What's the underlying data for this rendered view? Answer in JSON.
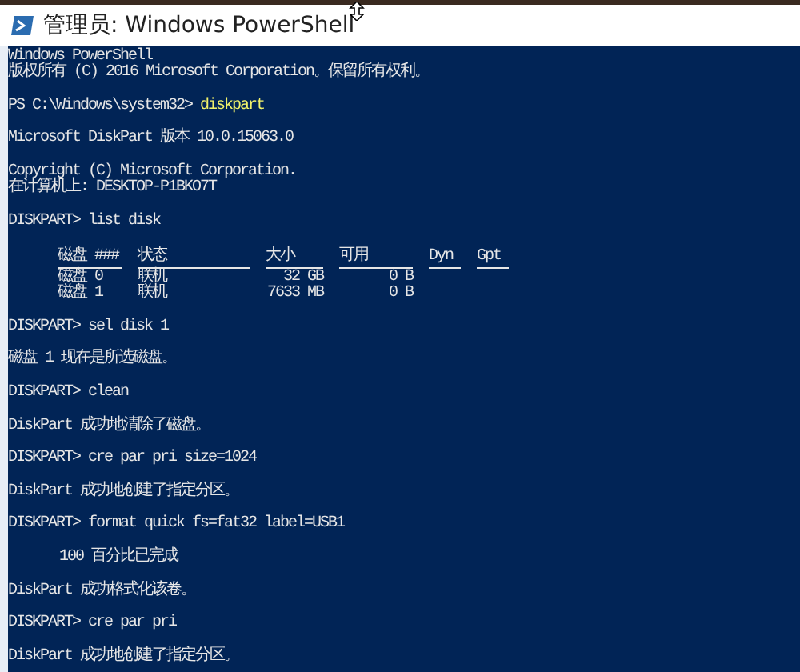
{
  "window": {
    "title": "管理员: Windows PowerShell"
  },
  "console": [
    {
      "kind": "text",
      "text": "Windows PowerShell"
    },
    {
      "kind": "text",
      "text": "版权所有 (C) 2016 Microsoft Corporation。保留所有权利。"
    },
    {
      "kind": "blank"
    },
    {
      "kind": "ps_command",
      "prompt": "PS C:\\Windows\\system32> ",
      "command": "diskpart"
    },
    {
      "kind": "blank"
    },
    {
      "kind": "text",
      "text": "Microsoft DiskPart 版本 10.0.15063.0"
    },
    {
      "kind": "blank"
    },
    {
      "kind": "text",
      "text": "Copyright (C) Microsoft Corporation."
    },
    {
      "kind": "text",
      "text": "在计算机上: DESKTOP-P1BKO7T"
    },
    {
      "kind": "blank"
    },
    {
      "kind": "text",
      "text": "DISKPART> list disk"
    },
    {
      "kind": "blank"
    },
    {
      "kind": "table",
      "columns": [
        "磁盘 ###",
        "状态",
        "大小",
        "可用",
        "Dyn",
        "Gpt"
      ],
      "rows": [
        [
          "磁盘 0",
          "联机",
          "32 GB",
          "0 B"
        ],
        [
          "磁盘 1",
          "联机",
          "7633 MB",
          "0 B"
        ]
      ]
    },
    {
      "kind": "blank"
    },
    {
      "kind": "text",
      "text": "DISKPART> sel disk 1"
    },
    {
      "kind": "blank"
    },
    {
      "kind": "text",
      "text": "磁盘 1 现在是所选磁盘。"
    },
    {
      "kind": "blank"
    },
    {
      "kind": "text",
      "text": "DISKPART> clean"
    },
    {
      "kind": "blank"
    },
    {
      "kind": "text",
      "text": "DiskPart 成功地清除了磁盘。"
    },
    {
      "kind": "blank"
    },
    {
      "kind": "text",
      "text": "DISKPART> cre par pri size=1024"
    },
    {
      "kind": "blank"
    },
    {
      "kind": "text",
      "text": "DiskPart 成功地创建了指定分区。"
    },
    {
      "kind": "blank"
    },
    {
      "kind": "text",
      "text": "DISKPART> format quick fs=fat32 label=USB1"
    },
    {
      "kind": "blank"
    },
    {
      "kind": "indented",
      "text": "100 百分比已完成"
    },
    {
      "kind": "blank"
    },
    {
      "kind": "text",
      "text": "DiskPart 成功格式化该卷。"
    },
    {
      "kind": "blank"
    },
    {
      "kind": "text",
      "text": "DISKPART> cre par pri"
    },
    {
      "kind": "blank"
    },
    {
      "kind": "text",
      "text": "DiskPart 成功地创建了指定分区。"
    }
  ]
}
